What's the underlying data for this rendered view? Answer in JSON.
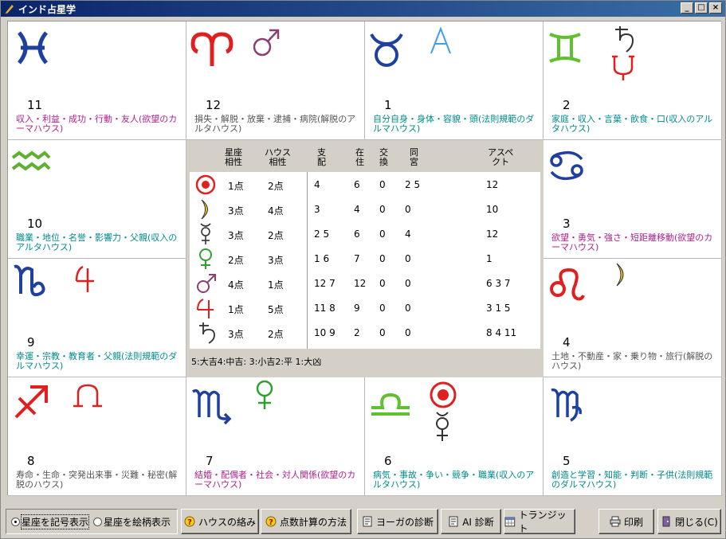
{
  "window": {
    "title": "インド占星学"
  },
  "houses": [
    {
      "slot": 0,
      "num": "11",
      "desc": "収入・利益・成功・行動・友人(欲望のカーマハウス)",
      "color": "#b0208c"
    },
    {
      "slot": 1,
      "num": "12",
      "desc": "損失・解脱・放棄・逮捕・病院(解脱のアルタハウス)",
      "color": "#555555"
    },
    {
      "slot": 2,
      "num": "1",
      "desc": "自分自身・身体・容貌・頭(法則規範のダルマハウス)",
      "color": "#008b8b"
    },
    {
      "slot": 3,
      "num": "2",
      "desc": "家庭・収入・言葉・飲食・口(収入のアルタハウス)",
      "color": "#008b8b"
    },
    {
      "slot": 4,
      "num": "10",
      "desc": "職業・地位・名誉・影響力・父親(収入のアルタハウス)",
      "color": "#008b8b"
    },
    {
      "slot": 5,
      "num": "3",
      "desc": "欲望・勇気・強さ・短距離移動(欲望のカーマハウス)",
      "color": "#b0208c"
    },
    {
      "slot": 6,
      "num": "9",
      "desc": "幸運・宗教・教育者・父親(法則規範のダルマハウス)",
      "color": "#008b8b"
    },
    {
      "slot": 7,
      "num": "4",
      "desc": "土地・不動産・家・乗り物・旅行(解脱のハウス)",
      "color": "#555555"
    },
    {
      "slot": 8,
      "num": "8",
      "desc": "寿命・生命・突発出来事・災難・秘密(解脱のハウス)",
      "color": "#555555"
    },
    {
      "slot": 9,
      "num": "7",
      "desc": "結婚・配偶者・社会・対人関係(欲望のカーマハウス)",
      "color": "#b0208c"
    },
    {
      "slot": 10,
      "num": "6",
      "desc": "病気・事故・争い・競争・職業(収入のアルタハウス)",
      "color": "#008b8b"
    },
    {
      "slot": 11,
      "num": "5",
      "desc": "創造と学習・知能・判断・子供(法則規範のダルマハウス)",
      "color": "#008b8b"
    }
  ],
  "table": {
    "headers": {
      "seiza_l1": "星座",
      "seiza_l2": "相性",
      "house_l1": "ハウス",
      "house_l2": "相性",
      "shihai_l1": "支",
      "shihai_l2": "配",
      "zaiju_l1": "在",
      "zaiju_l2": "住",
      "kokan_l1": "交",
      "kokan_l2": "換",
      "dokyu_l1": "同",
      "dokyu_l2": "宮",
      "aspect_l1": "アスペ",
      "aspect_l2": "クト"
    },
    "rows": [
      {
        "planet": "sun-icon",
        "seiza": "1点",
        "house": "2点",
        "shihai": "4",
        "zaiju": "6",
        "kokan": "0",
        "dokyu": "2 5",
        "aspect": "12"
      },
      {
        "planet": "moon-icon",
        "seiza": "3点",
        "house": "4点",
        "shihai": "3",
        "zaiju": "4",
        "kokan": "0",
        "dokyu": "0",
        "aspect": "10"
      },
      {
        "planet": "mercury-icon",
        "seiza": "3点",
        "house": "2点",
        "shihai": "2 5",
        "zaiju": "6",
        "kokan": "0",
        "dokyu": "4",
        "aspect": "12"
      },
      {
        "planet": "venus-icon",
        "seiza": "2点",
        "house": "3点",
        "shihai": "1 6",
        "zaiju": "7",
        "kokan": "0",
        "dokyu": "0",
        "aspect": "1"
      },
      {
        "planet": "mars-icon",
        "seiza": "4点",
        "house": "1点",
        "shihai": "12 7",
        "zaiju": "12",
        "kokan": "0",
        "dokyu": "0",
        "aspect": "6 3 7"
      },
      {
        "planet": "jupiter-icon",
        "seiza": "1点",
        "house": "5点",
        "shihai": "11 8",
        "zaiju": "9",
        "kokan": "0",
        "dokyu": "0",
        "aspect": "3 1 5"
      },
      {
        "planet": "saturn-icon",
        "seiza": "3点",
        "house": "2点",
        "shihai": "10 9",
        "zaiju": "2",
        "kokan": "0",
        "dokyu": "0",
        "aspect": "8 4 11"
      }
    ],
    "legend": "5:大吉4:中吉: 3:小吉2:平 1:大凶"
  },
  "controls": {
    "radio_symbol": "星座を記号表示",
    "radio_picture": "星座を絵柄表示",
    "btn_house": "ハウスの絡み",
    "btn_points": "点数計算の方法",
    "btn_yoga": "ヨーガの診断",
    "btn_ai": "AI 診断",
    "btn_transit": "トランジット",
    "btn_print": "印刷",
    "btn_close": "閉じる(C)"
  }
}
